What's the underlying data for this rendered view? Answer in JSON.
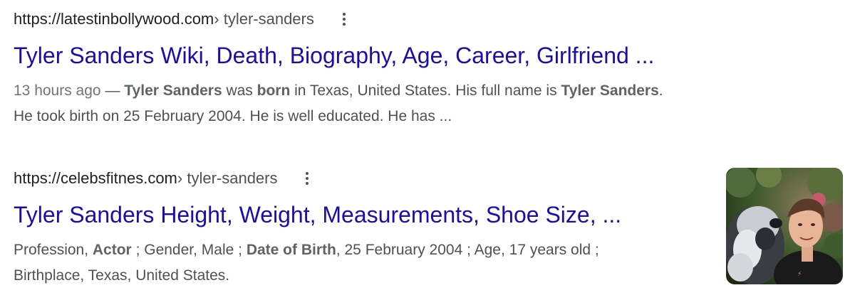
{
  "results": [
    {
      "domain": "https://latestinbollywood.com",
      "path": " › tyler-sanders",
      "title": "Tyler Sanders Wiki, Death, Biography, Age, Career, Girlfriend ...",
      "date": "13 hours ago",
      "date_sep": " — ",
      "snippet": {
        "s1": "Tyler Sanders",
        "s2": " was ",
        "s3": "born",
        "s4": " in Texas, United States. His full name is ",
        "s5": "Tyler Sanders",
        "s6": ".",
        "line2": "He took birth on 25 February 2004. He is well educated. He has ..."
      }
    },
    {
      "domain": "https://celebsfitnes.com",
      "path": " › tyler-sanders",
      "title": "Tyler Sanders Height, Weight, Measurements, Shoe Size, ...",
      "snippet": {
        "s1": "Profession, ",
        "s2": "Actor",
        "s3": " ; Gender, Male ; ",
        "s4": "Date of Birth",
        "s5": ", 25 February 2004 ; Age, 17 years old ;",
        "line2": "Birthplace, Texas, United States."
      }
    }
  ],
  "icons": {
    "more": "more-vert-icon"
  }
}
